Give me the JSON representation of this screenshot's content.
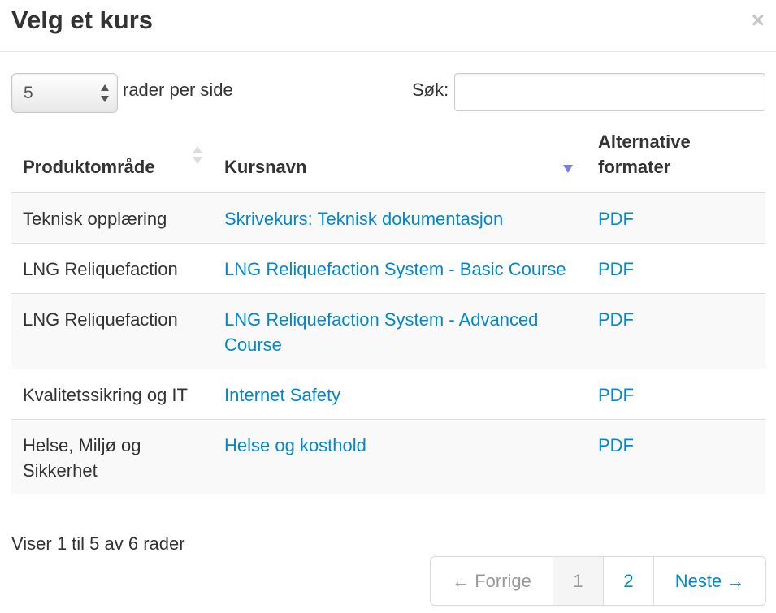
{
  "dialog": {
    "title": "Velg et kurs",
    "close_glyph": "×"
  },
  "length": {
    "value": "5",
    "label": "rader per side"
  },
  "search": {
    "label": "Søk:",
    "value": ""
  },
  "table": {
    "columns": [
      {
        "label": "Produktområde",
        "sort": "both"
      },
      {
        "label": "Kursnavn",
        "sort": "desc"
      },
      {
        "label": "Alternative formater",
        "sort": "none"
      }
    ],
    "rows": [
      {
        "area": "Teknisk opplæring",
        "course": "Skrivekurs: Teknisk dokumentasjon",
        "format": "PDF"
      },
      {
        "area": "LNG Reliquefaction",
        "course": "LNG Reliquefaction System - Basic Course",
        "format": "PDF"
      },
      {
        "area": "LNG Reliquefaction",
        "course": "LNG Reliquefaction System - Advanced Course",
        "format": "PDF"
      },
      {
        "area": "Kvalitetssikring og IT",
        "course": "Internet Safety",
        "format": "PDF"
      },
      {
        "area": "Helse, Miljø og Sikkerhet",
        "course": "Helse og kosthold",
        "format": "PDF"
      }
    ]
  },
  "info": "Viser 1 til 5 av 6 rader",
  "pagination": {
    "prev": "← Forrige",
    "pages": [
      "1",
      "2"
    ],
    "current_page": "1",
    "next": "Neste →"
  },
  "colors": {
    "link": "#0088cc",
    "sort_active": "#7b7fd6",
    "sort_inactive": "#d3d3d3"
  }
}
